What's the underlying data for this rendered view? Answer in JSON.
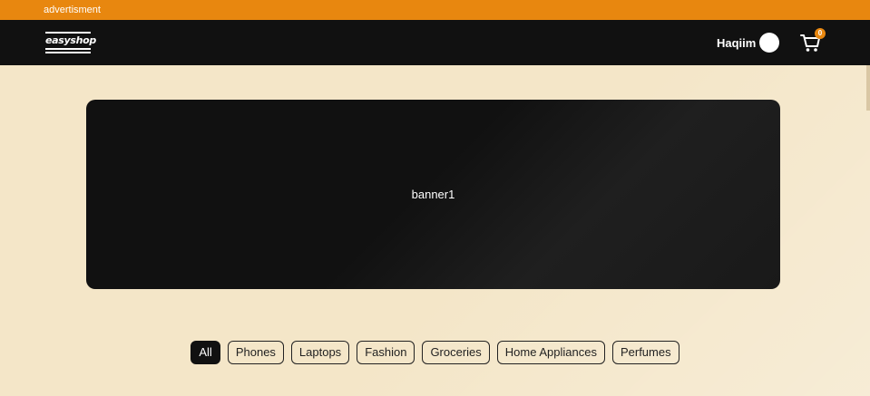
{
  "ad_bar": {
    "label": "advertisment"
  },
  "header": {
    "logo_text": "easyshop",
    "user_name": "Haqiim",
    "cart_count": "0"
  },
  "banner": {
    "label": "banner1"
  },
  "categories": [
    {
      "label": "All",
      "active": true
    },
    {
      "label": "Phones",
      "active": false
    },
    {
      "label": "Laptops",
      "active": false
    },
    {
      "label": "Fashion",
      "active": false
    },
    {
      "label": "Groceries",
      "active": false
    },
    {
      "label": "Home Appliances",
      "active": false
    },
    {
      "label": "Perfumes",
      "active": false
    }
  ],
  "colors": {
    "accent": "#e8870f",
    "header_bg": "#111111",
    "page_bg": "#f4e6c8"
  },
  "icons": {
    "cart": "cart-icon",
    "avatar": "avatar"
  }
}
